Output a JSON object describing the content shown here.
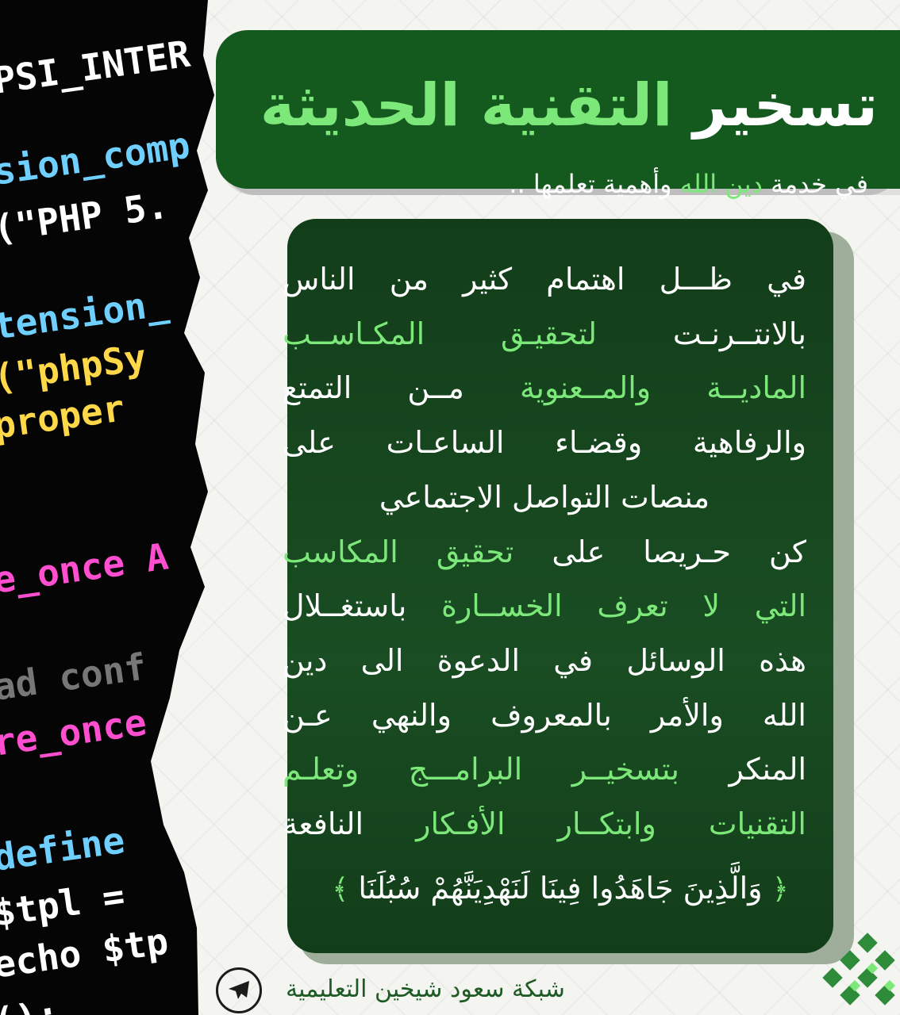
{
  "code_lines": [
    {
      "text": "PSI_INTER",
      "color": "#ffffff"
    },
    {
      "text": "sion_comp",
      "color": "#6fd0ff"
    },
    {
      "text": "(\"PHP 5.",
      "color": "#ffffff"
    },
    {
      "text": "tension_",
      "color": "#6fd0ff"
    },
    {
      "text": "(\"phpSy",
      "color": "#ffd84a"
    },
    {
      "text": "proper",
      "color": "#ffd84a"
    },
    {
      "text": "e_once A",
      "color": "#ff4fd0"
    },
    {
      "text": "ad conf",
      "color": "#777777"
    },
    {
      "text": "re_once",
      "color": "#ff4fd0"
    },
    {
      "text": "define",
      "color": "#6fd0ff"
    },
    {
      "text": "$tpl =",
      "color": "#ffffff"
    },
    {
      "text": "echo $tp",
      "color": "#ffffff"
    },
    {
      "text": "();",
      "color": "#ffffff"
    }
  ],
  "banner": {
    "title_white": "تسخير",
    "title_green": "التقنية الحديثة",
    "subtitle_part1": "في خدمة",
    "subtitle_green": "دين الله",
    "subtitle_part2": "وأهمية تعلمها .."
  },
  "paragraph": [
    [
      {
        "t": "في ظـــل اهتمام كثير من الناس",
        "h": false
      }
    ],
    [
      {
        "t": "بالانتــرنـت ",
        "h": false
      },
      {
        "t": "لتحقيـق المكـاســب",
        "h": true
      }
    ],
    [
      {
        "t": "الماديــة والمــعنوية",
        "h": true
      },
      {
        "t": " مــن التمتع",
        "h": false
      }
    ],
    [
      {
        "t": "والرفاهية وقضـاء الساعـات على",
        "h": false
      }
    ],
    [
      {
        "t": "منصات التواصل الاجتماعي",
        "h": false,
        "center": true
      }
    ],
    [
      {
        "t": "كن حـريصا على ",
        "h": false
      },
      {
        "t": "تحقيق المكاسب",
        "h": true
      }
    ],
    [
      {
        "t": "التي لا تعرف الخســارة",
        "h": true
      },
      {
        "t": " باستغــلال",
        "h": false
      }
    ],
    [
      {
        "t": "هذه الوسائل في الدعوة الى دين",
        "h": false
      }
    ],
    [
      {
        "t": "الله والأمر بالمعروف والنهي عـن",
        "h": false
      }
    ],
    [
      {
        "t": "المنكر ",
        "h": false
      },
      {
        "t": "بتسخيــر البرامـــج وتعلـم",
        "h": true
      }
    ],
    [
      {
        "t": "التقنيات وابتكــار الأفـكار",
        "h": true
      },
      {
        "t": " النافعة",
        "h": false
      }
    ]
  ],
  "verse": "وَالَّذِينَ جَاهَدُوا فِينَا لَنَهْدِيَنَّهُمْ سُبُلَنَا",
  "footer": {
    "network": "شبكة سعود شيخين التعليمية"
  },
  "colors": {
    "dark_green": "#145a1e",
    "accent_green": "#7de87a",
    "card_green": "#1a4d23"
  }
}
